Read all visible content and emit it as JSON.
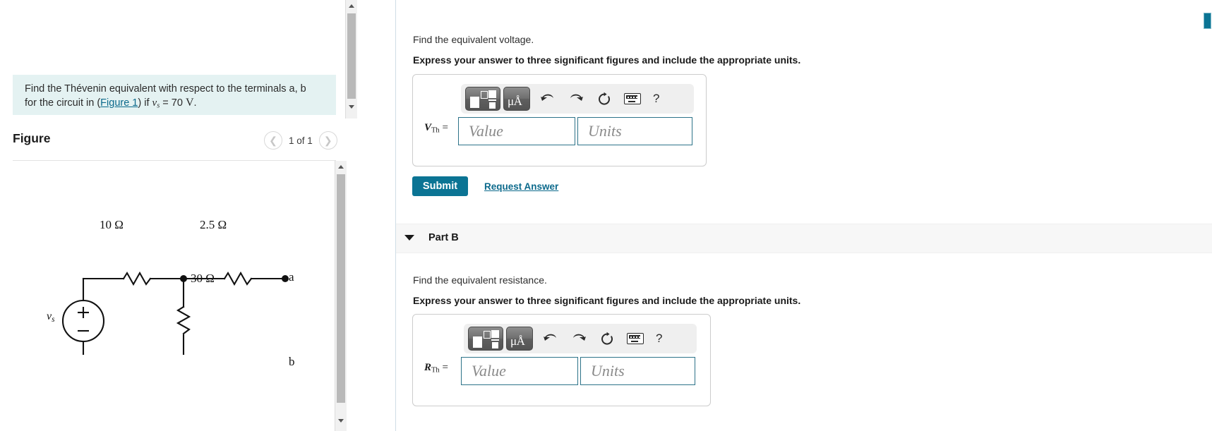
{
  "left_panel": {
    "problem_statement": {
      "line1_a": "Find the Thévenin equivalent with respect to the terminals a, b",
      "line2_a": "for the circuit in (",
      "figure_link": "Figure 1",
      "line2_b": ") if ",
      "var_v": "v",
      "var_sub": "s",
      "eq": " = 70 ",
      "unit_V": "V",
      "period": "."
    },
    "figure_header": {
      "title": "Figure",
      "prev_icon": "chevron-left-icon",
      "counter": "1 of 1",
      "next_icon": "chevron-right-icon"
    },
    "circuit": {
      "source_label": "v",
      "source_sub": "s",
      "source_plus": "+",
      "source_minus": "−",
      "r_top_left": "10 Ω",
      "r_top_right": "2.5 Ω",
      "r_shunt": "30 Ω",
      "terminal_a": "a",
      "terminal_b": "b"
    }
  },
  "right_panel": {
    "part_a": {
      "prompt": "Find the equivalent voltage.",
      "instruction": "Express your answer to three significant figures and include the appropriate units.",
      "toolbar": {
        "template_button": "template-icon",
        "units_button": "micro-angstrom-icon",
        "undo": "undo-icon",
        "redo": "redo-icon",
        "reset": "reset-icon",
        "keyboard": "keyboard-icon",
        "help": "?"
      },
      "answer_label_main": "V",
      "answer_label_sub": "Th",
      "answer_label_eq": " =",
      "value_placeholder": "Value",
      "units_placeholder": "Units",
      "submit_label": "Submit",
      "request_answer_label": "Request Answer"
    },
    "part_b": {
      "header_label": "Part B",
      "caret_icon": "caret-down-icon",
      "prompt": "Find the equivalent resistance.",
      "instruction": "Express your answer to three significant figures and include the appropriate units.",
      "toolbar": {
        "template_button": "template-icon",
        "units_button": "micro-angstrom-icon",
        "undo": "undo-icon",
        "redo": "redo-icon",
        "reset": "reset-icon",
        "keyboard": "keyboard-icon",
        "help": "?"
      },
      "answer_label_main": "R",
      "answer_label_sub": "Th",
      "answer_label_eq": " =",
      "value_placeholder": "Value",
      "units_placeholder": "Units"
    }
  },
  "colors": {
    "accent_teal": "#0b7494",
    "link": "#0c6a8c",
    "problem_bg": "#e4f2f2",
    "field_border": "#2d7389",
    "partb_bar_bg": "#f7f7f7"
  }
}
